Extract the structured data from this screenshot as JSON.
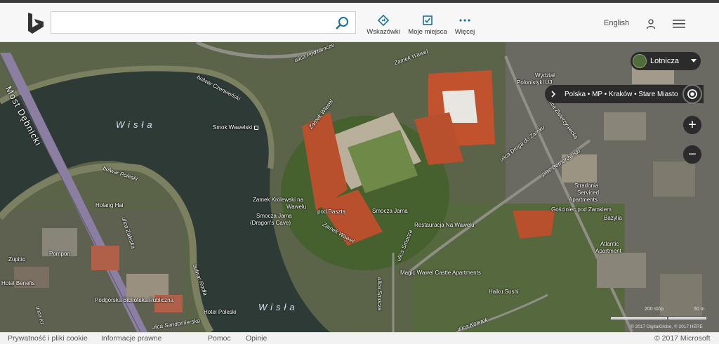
{
  "header": {
    "search_placeholder": "",
    "buttons": [
      {
        "label": "Wskazówki",
        "icon": "directions-icon"
      },
      {
        "label": "Moje miejsca",
        "icon": "my-places-icon"
      },
      {
        "label": "Więcej",
        "icon": "more-icon"
      }
    ],
    "language": "English"
  },
  "map": {
    "style_selector": "Lotnicza",
    "breadcrumb": "Polska • MP • Kraków • Stare Miasto",
    "labels": {
      "most_debnicki": "Most Dębnicki",
      "wisla_top": "Wisła",
      "wisla_bottom": "Wisła",
      "bulwar_czerwienski": "bulwar Czerwieński",
      "bulwar_poleski": "bulwar Poleski",
      "bulwar_rodla": "bulwar Rodła",
      "ulica_podzamcze": "ulica Podzamcze",
      "zamek_wawel_top": "Zamek Wawel",
      "zamek_wawel_left": "Zamek Wawel",
      "zamek_wawel_mid": "Zamek Wawel",
      "smok_wawelski": "Smok Wawelski",
      "zamek_krolewski": "Zamek Królewski na",
      "zamek_krolewski2": "Wawelu",
      "smocza_jama": "Smocza Jama",
      "smocza_jama2": "(Dragon's Cave)",
      "pod_baszta": "pod Basztą",
      "smocza_jama_r": "Smocza Jama",
      "restauracja": "Restauracja Na Wawelu",
      "ulica_smocza_v": "ulica Smocza",
      "ulica_smocza_b": "ulica Smocza",
      "magic_wawel": "Magic Wawel Castle Apartments",
      "haiku_sushi": "Haiku Sushi",
      "ulica_koletek": "ulica Koletek",
      "ulica_droga": "ulica Droga do Zamku",
      "plac_bernardynski": "plac Bernardyński",
      "stradonia": "Stradonia",
      "stradonia2": "Serviced",
      "stradonia3": "Apartments",
      "goscinie": "Gościniec pod Zamkiem",
      "bazylia": "Bazylia",
      "atlantic": "Atlantic",
      "atlantic2": "Apartment",
      "wydzial": "Wydział",
      "wydzial2": "Polonistyki UJ",
      "ulica_zwierzyniecka": "ulica Zwierzyniecka",
      "holang": "Holang Hai",
      "ulica_zaleska": "ulica Zaleska",
      "pompon": "Pompon",
      "zupitto": "Zupitto",
      "hotel_benefis": "Hotel Benefis",
      "biblioteka": "Podgórska Biblioteka Publiczna",
      "hotel_poleski": "Hotel Poleski",
      "ulica_sandomierska": "ulica Sandomierska",
      "ulica_kr": "ulica Kr"
    },
    "scale": {
      "left": "200 stóp",
      "right": "50 m"
    },
    "copyright": "© 2017 DigitalGlobe, © 2017 HERE"
  },
  "footer": {
    "privacy": "Prywatność i pliki cookie",
    "legal": "Informacje prawne",
    "help": "Pomoc",
    "feedback": "Opinie",
    "copyright": "© 2017 Microsoft"
  }
}
